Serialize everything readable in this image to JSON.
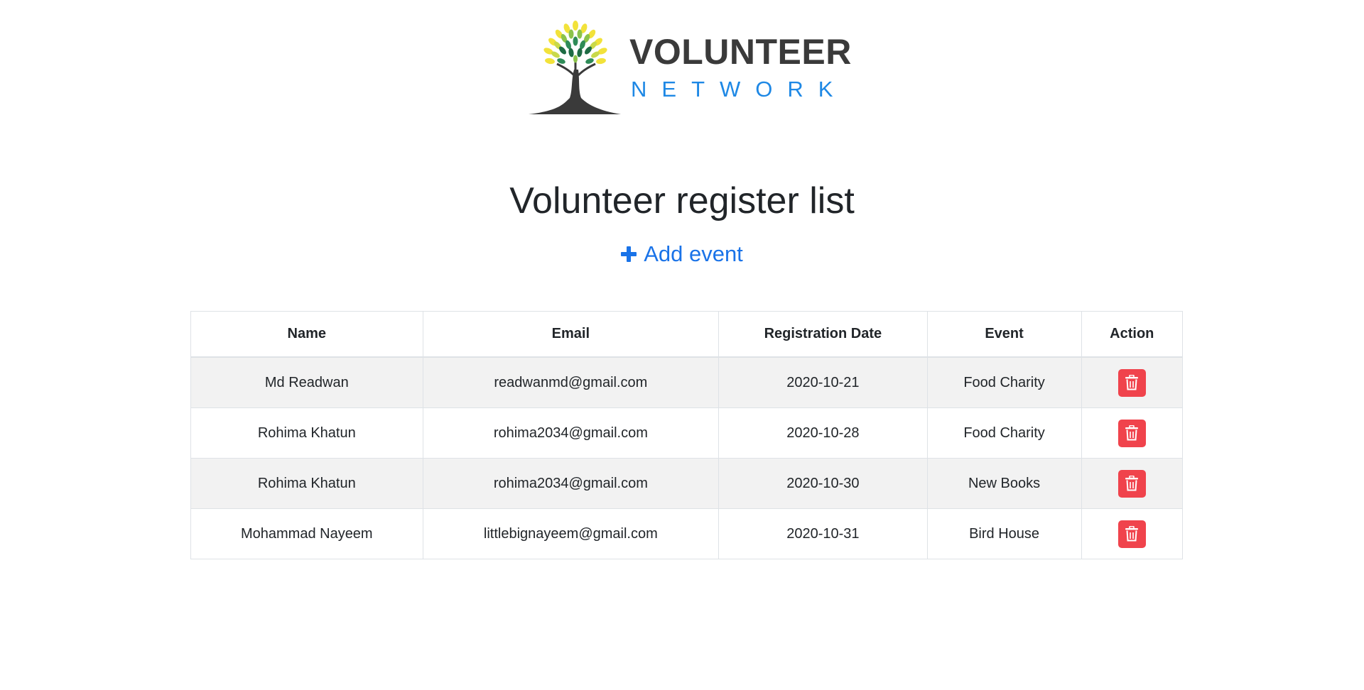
{
  "brand": {
    "name": "VOLUNTEER",
    "tagline": "NETWORK",
    "colors": {
      "name": "#3a3a3a",
      "tagline": "#1e88e5",
      "leaf_yellow": "#f2e23a",
      "leaf_green": "#2e8b57",
      "trunk": "#3a3a3a"
    }
  },
  "page": {
    "title": "Volunteer register list"
  },
  "actions": {
    "add_event_label": "Add event",
    "add_event_icon": "plus-icon",
    "accent": "#1a73e8"
  },
  "table": {
    "headers": {
      "name": "Name",
      "email": "Email",
      "date": "Registration Date",
      "event": "Event",
      "action": "Action"
    },
    "rows": [
      {
        "name": "Md Readwan",
        "email": "readwanmd@gmail.com",
        "date": "2020-10-21",
        "event": "Food Charity"
      },
      {
        "name": "Rohima Khatun",
        "email": "rohima2034@gmail.com",
        "date": "2020-10-28",
        "event": "Food Charity"
      },
      {
        "name": "Rohima Khatun",
        "email": "rohima2034@gmail.com",
        "date": "2020-10-30",
        "event": "New Books"
      },
      {
        "name": "Mohammad Nayeem",
        "email": "littlebignayeem@gmail.com",
        "date": "2020-10-31",
        "event": "Bird House"
      }
    ],
    "row_action_icon": "trash-icon",
    "delete_color": "#f0434c"
  }
}
